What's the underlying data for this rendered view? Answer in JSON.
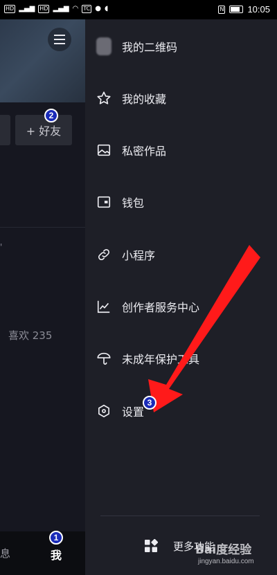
{
  "status_bar": {
    "left_indicators": [
      "HD",
      "4G",
      "4G",
      "wifi",
      "TC",
      "qq-icon",
      "message-icon"
    ],
    "time": "10:05"
  },
  "left_page": {
    "add_friend_label": "+ 好友",
    "likes_label": "喜欢 235",
    "tabs": [
      {
        "label": "息"
      },
      {
        "label": "我"
      }
    ]
  },
  "drawer": {
    "items": [
      {
        "label": "我的二维码",
        "icon": "avatar"
      },
      {
        "label": "我的收藏",
        "icon": "star-icon"
      },
      {
        "label": "私密作品",
        "icon": "image-icon"
      },
      {
        "label": "钱包",
        "icon": "wallet-icon"
      },
      {
        "label": "小程序",
        "icon": "link-icon"
      },
      {
        "label": "创作者服务中心",
        "icon": "chart-icon"
      },
      {
        "label": "未成年保护工具",
        "icon": "umbrella-icon"
      },
      {
        "label": "设置",
        "icon": "hexagon-settings-icon"
      }
    ],
    "more_label": "更多功能"
  },
  "annotations": {
    "markers": [
      "1",
      "2",
      "3"
    ],
    "arrow_color": "#ff1a1a"
  },
  "watermark": {
    "text": "Bai度经验",
    "subtext": "jingyan.baidu.com"
  },
  "colors": {
    "drawer_bg": "#1e1f27",
    "page_bg": "#161720",
    "marker_blue": "#1a2bb8"
  }
}
